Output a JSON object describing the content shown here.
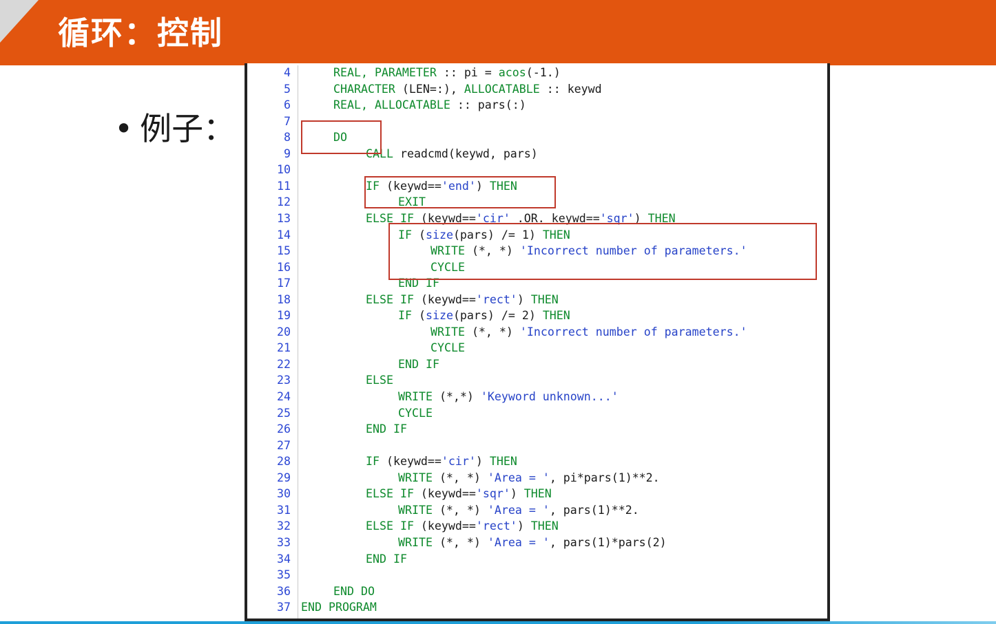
{
  "header": {
    "title": "循环：控制",
    "bg_color": "#e2550f"
  },
  "bullet": {
    "dot": "•",
    "text": "例子："
  },
  "colors": {
    "keyword": "#0e8a2c",
    "string": "#2743c8",
    "line_number": "#2b46d4",
    "highlight": "#c0392b"
  },
  "code": [
    {
      "num": "4",
      "indent": 4,
      "tokens": [
        [
          "kw",
          "REAL, PARAMETER"
        ],
        [
          "t",
          " :: pi = "
        ],
        [
          "kw",
          "acos"
        ],
        [
          "t",
          "(-1.)"
        ]
      ]
    },
    {
      "num": "5",
      "indent": 4,
      "tokens": [
        [
          "kw",
          "CHARACTER"
        ],
        [
          "t",
          " (LEN=:), "
        ],
        [
          "kw",
          "ALLOCATABLE"
        ],
        [
          "t",
          " :: keywd"
        ]
      ]
    },
    {
      "num": "6",
      "indent": 4,
      "tokens": [
        [
          "kw",
          "REAL, ALLOCATABLE"
        ],
        [
          "t",
          " :: pars(:)"
        ]
      ]
    },
    {
      "num": "7",
      "indent": 0,
      "tokens": []
    },
    {
      "num": "8",
      "indent": 4,
      "tokens": [
        [
          "kw",
          "DO"
        ]
      ]
    },
    {
      "num": "9",
      "indent": 8,
      "tokens": [
        [
          "kw",
          "CALL"
        ],
        [
          "t",
          " readcmd(keywd, pars)"
        ]
      ]
    },
    {
      "num": "10",
      "indent": 0,
      "tokens": []
    },
    {
      "num": "11",
      "indent": 8,
      "tokens": [
        [
          "kw",
          "IF"
        ],
        [
          "t",
          " (keywd=="
        ],
        [
          "st",
          "'end'"
        ],
        [
          "t",
          ") "
        ],
        [
          "kw",
          "THEN"
        ]
      ]
    },
    {
      "num": "12",
      "indent": 12,
      "tokens": [
        [
          "kw",
          "EXIT"
        ]
      ]
    },
    {
      "num": "13",
      "indent": 8,
      "tokens": [
        [
          "kw",
          "ELSE IF"
        ],
        [
          "t",
          " (keywd=="
        ],
        [
          "st",
          "'cir'"
        ],
        [
          "t",
          " .OR. keywd=="
        ],
        [
          "st",
          "'sqr'"
        ],
        [
          "t",
          ") "
        ],
        [
          "kw",
          "THEN"
        ]
      ]
    },
    {
      "num": "14",
      "indent": 12,
      "tokens": [
        [
          "kw",
          "IF"
        ],
        [
          "t",
          " ("
        ],
        [
          "st",
          "size"
        ],
        [
          "t",
          "(pars) /= 1) "
        ],
        [
          "kw",
          "THEN"
        ]
      ]
    },
    {
      "num": "15",
      "indent": 16,
      "tokens": [
        [
          "kw",
          "WRITE"
        ],
        [
          "t",
          " (*, *) "
        ],
        [
          "st",
          "'Incorrect number of parameters.'"
        ]
      ]
    },
    {
      "num": "16",
      "indent": 16,
      "tokens": [
        [
          "kw",
          "CYCLE"
        ]
      ]
    },
    {
      "num": "17",
      "indent": 12,
      "tokens": [
        [
          "kw",
          "END IF"
        ]
      ]
    },
    {
      "num": "18",
      "indent": 8,
      "tokens": [
        [
          "kw",
          "ELSE IF"
        ],
        [
          "t",
          " (keywd=="
        ],
        [
          "st",
          "'rect'"
        ],
        [
          "t",
          ") "
        ],
        [
          "kw",
          "THEN"
        ]
      ]
    },
    {
      "num": "19",
      "indent": 12,
      "tokens": [
        [
          "kw",
          "IF"
        ],
        [
          "t",
          " ("
        ],
        [
          "st",
          "size"
        ],
        [
          "t",
          "(pars) /= 2) "
        ],
        [
          "kw",
          "THEN"
        ]
      ]
    },
    {
      "num": "20",
      "indent": 16,
      "tokens": [
        [
          "kw",
          "WRITE"
        ],
        [
          "t",
          " (*, *) "
        ],
        [
          "st",
          "'Incorrect number of parameters.'"
        ]
      ]
    },
    {
      "num": "21",
      "indent": 16,
      "tokens": [
        [
          "kw",
          "CYCLE"
        ]
      ]
    },
    {
      "num": "22",
      "indent": 12,
      "tokens": [
        [
          "kw",
          "END IF"
        ]
      ]
    },
    {
      "num": "23",
      "indent": 8,
      "tokens": [
        [
          "kw",
          "ELSE"
        ]
      ]
    },
    {
      "num": "24",
      "indent": 12,
      "tokens": [
        [
          "kw",
          "WRITE"
        ],
        [
          "t",
          " (*,*) "
        ],
        [
          "st",
          "'Keyword unknown...'"
        ]
      ]
    },
    {
      "num": "25",
      "indent": 12,
      "tokens": [
        [
          "kw",
          "CYCLE"
        ]
      ]
    },
    {
      "num": "26",
      "indent": 8,
      "tokens": [
        [
          "kw",
          "END IF"
        ]
      ]
    },
    {
      "num": "27",
      "indent": 0,
      "tokens": []
    },
    {
      "num": "28",
      "indent": 8,
      "tokens": [
        [
          "kw",
          "IF"
        ],
        [
          "t",
          " (keywd=="
        ],
        [
          "st",
          "'cir'"
        ],
        [
          "t",
          ") "
        ],
        [
          "kw",
          "THEN"
        ]
      ]
    },
    {
      "num": "29",
      "indent": 12,
      "tokens": [
        [
          "kw",
          "WRITE"
        ],
        [
          "t",
          " (*, *) "
        ],
        [
          "st",
          "'Area = '"
        ],
        [
          "t",
          ", pi*pars(1)**2."
        ]
      ]
    },
    {
      "num": "30",
      "indent": 8,
      "tokens": [
        [
          "kw",
          "ELSE IF"
        ],
        [
          "t",
          " (keywd=="
        ],
        [
          "st",
          "'sqr'"
        ],
        [
          "t",
          ") "
        ],
        [
          "kw",
          "THEN"
        ]
      ]
    },
    {
      "num": "31",
      "indent": 12,
      "tokens": [
        [
          "kw",
          "WRITE"
        ],
        [
          "t",
          " (*, *) "
        ],
        [
          "st",
          "'Area = '"
        ],
        [
          "t",
          ", pars(1)**2."
        ]
      ]
    },
    {
      "num": "32",
      "indent": 8,
      "tokens": [
        [
          "kw",
          "ELSE IF"
        ],
        [
          "t",
          " (keywd=="
        ],
        [
          "st",
          "'rect'"
        ],
        [
          "t",
          ") "
        ],
        [
          "kw",
          "THEN"
        ]
      ]
    },
    {
      "num": "33",
      "indent": 12,
      "tokens": [
        [
          "kw",
          "WRITE"
        ],
        [
          "t",
          " (*, *) "
        ],
        [
          "st",
          "'Area = '"
        ],
        [
          "t",
          ", pars(1)*pars(2)"
        ]
      ]
    },
    {
      "num": "34",
      "indent": 8,
      "tokens": [
        [
          "kw",
          "END IF"
        ]
      ]
    },
    {
      "num": "35",
      "indent": 0,
      "tokens": []
    },
    {
      "num": "36",
      "indent": 4,
      "tokens": [
        [
          "kw",
          "END DO"
        ]
      ]
    },
    {
      "num": "37",
      "indent": 0,
      "tokens": [
        [
          "kw",
          "END PROGRAM"
        ]
      ]
    }
  ],
  "highlight_boxes": [
    {
      "label": "do-box"
    },
    {
      "label": "exit-box"
    },
    {
      "label": "cycle-box"
    }
  ]
}
